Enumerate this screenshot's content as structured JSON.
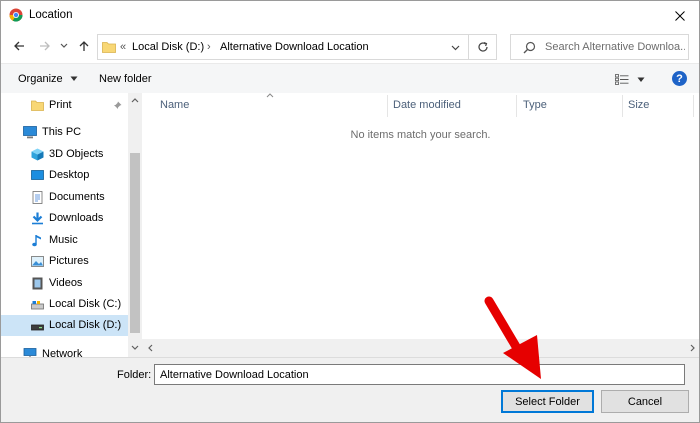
{
  "window": {
    "title": "Location"
  },
  "address": {
    "overflow_glyph": "«",
    "crumbs": [
      "Local Disk (D:)",
      "Alternative Download Location"
    ],
    "separator": "›"
  },
  "search": {
    "placeholder": "Search Alternative Downloa..."
  },
  "toolbar": {
    "organize_label": "Organize",
    "new_folder_label": "New folder"
  },
  "nav": {
    "items": [
      {
        "label": "Print",
        "icon": "folder-icon"
      },
      {
        "label": "This PC",
        "icon": "computer-icon"
      },
      {
        "label": "3D Objects",
        "icon": "3d-objects-icon"
      },
      {
        "label": "Desktop",
        "icon": "desktop-icon"
      },
      {
        "label": "Documents",
        "icon": "documents-icon"
      },
      {
        "label": "Downloads",
        "icon": "downloads-icon"
      },
      {
        "label": "Music",
        "icon": "music-icon"
      },
      {
        "label": "Pictures",
        "icon": "pictures-icon"
      },
      {
        "label": "Videos",
        "icon": "videos-icon"
      },
      {
        "label": "Local Disk (C:)",
        "icon": "drive-icon"
      },
      {
        "label": "Local Disk (D:)",
        "icon": "drive-icon"
      },
      {
        "label": "Network",
        "icon": "network-icon"
      }
    ],
    "selected": "Local Disk (D:)"
  },
  "columns": [
    "Name",
    "Date modified",
    "Type",
    "Size"
  ],
  "empty_message": "No items match your search.",
  "footer": {
    "folder_label": "Folder:",
    "folder_value": "Alternative Download Location",
    "select_label": "Select Folder",
    "cancel_label": "Cancel"
  },
  "colors": {
    "accent": "#0078d7",
    "selection": "#cce4f7",
    "arrow": "#e60000"
  }
}
